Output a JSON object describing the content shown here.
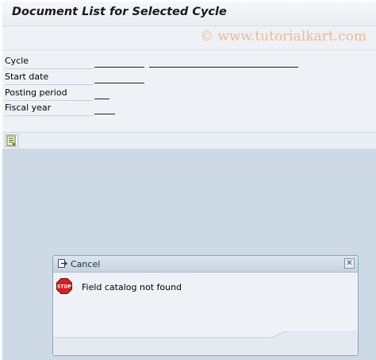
{
  "header": {
    "title": "Document List for Selected Cycle",
    "watermark": "© www.tutorialkart.com"
  },
  "form": {
    "fields": [
      {
        "label": "Cycle",
        "value": "",
        "description": ""
      },
      {
        "label": "Start date",
        "value": ""
      },
      {
        "label": "Posting period",
        "value": ""
      },
      {
        "label": "Fiscal year",
        "value": ""
      }
    ]
  },
  "toolbar": {
    "list_icon": "list-document-icon"
  },
  "dialog": {
    "title": "Cancel",
    "title_icon": "exit-icon",
    "close_icon": "close-icon",
    "close_glyph": "✕",
    "message_icon": "stop-icon",
    "stop_text": "STOP",
    "message": "Field catalog not found"
  },
  "colors": {
    "background": "#cddae6",
    "form_background": "#eef2f6",
    "watermark": "#efb98f",
    "stop_red": "#d72020"
  }
}
